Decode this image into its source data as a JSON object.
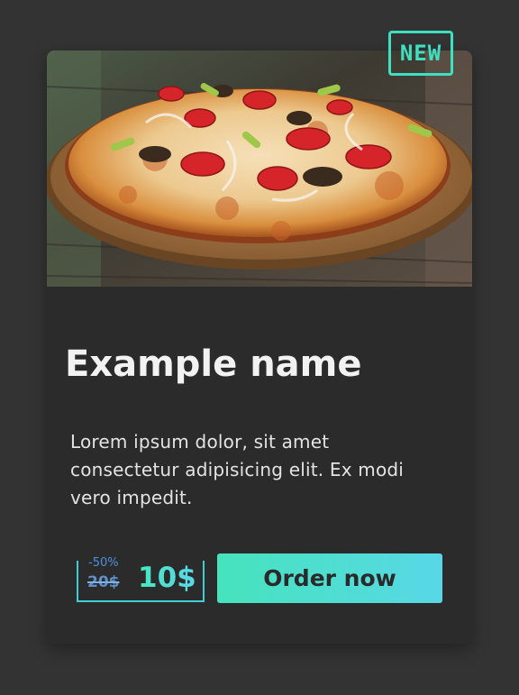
{
  "card": {
    "badge": "NEW",
    "title": "Example name",
    "description": "Lorem ipsum dolor, sit amet consectetur adipisicing elit. Ex modi vero impedit.",
    "price": {
      "discount": "-50%",
      "old_price": "20$",
      "new_price": "10$"
    },
    "order_button": "Order now",
    "image": "pizza-photo"
  },
  "colors": {
    "page_background": "#333333",
    "card_background": "#2b2b2b",
    "accent_start": "#46e3bd",
    "accent_end": "#58d8e6",
    "old_price_color": "#5e8fc8"
  }
}
